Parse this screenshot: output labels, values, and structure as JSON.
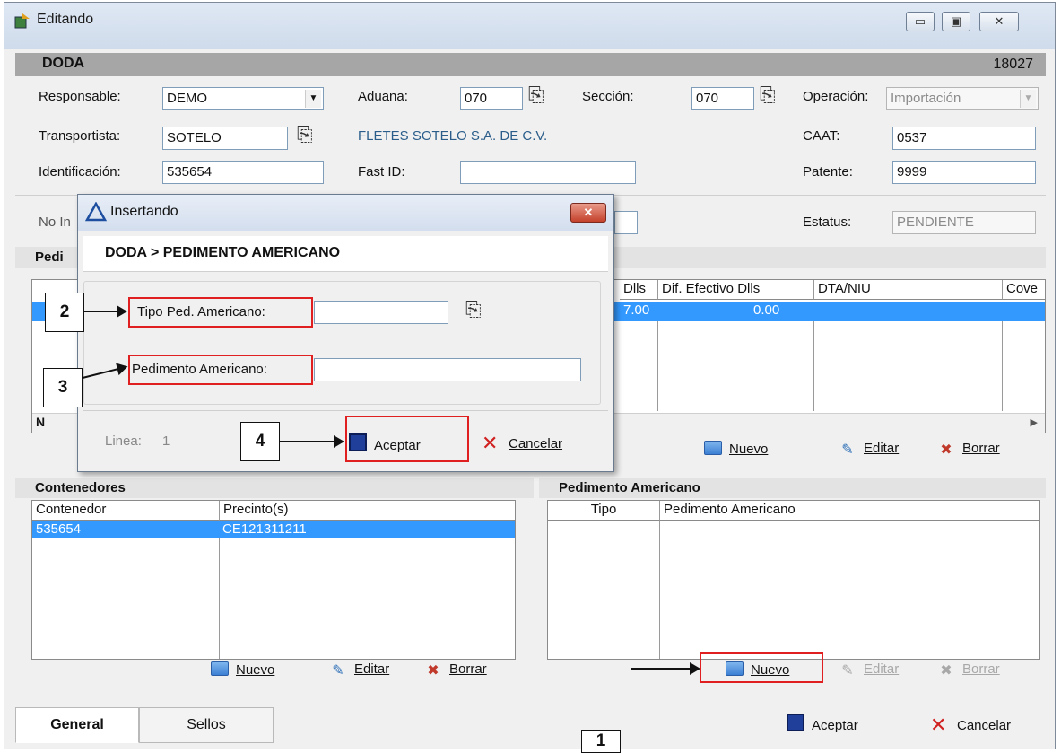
{
  "window": {
    "title": "Editando",
    "header_title": "DODA",
    "header_number": "18027",
    "controls": [
      "▭",
      "▣",
      "✕"
    ]
  },
  "form": {
    "responsable_label": "Responsable:",
    "responsable_value": "DEMO",
    "aduana_label": "Aduana:",
    "aduana_value": "070",
    "seccion_label": "Sección:",
    "seccion_value": "070",
    "operacion_label": "Operación:",
    "operacion_value": "Importación",
    "transportista_label": "Transportista:",
    "transportista_value": "SOTELO",
    "transportista_name": "FLETES SOTELO S.A. DE C.V.",
    "caat_label": "CAAT:",
    "caat_value": "0537",
    "identificacion_label": "Identificación:",
    "identificacion_value": "535654",
    "fastid_label": "Fast ID:",
    "fastid_value": "",
    "patente_label": "Patente:",
    "patente_value": "9999",
    "noin_label": "No In",
    "estatus_label": "Estatus:",
    "estatus_value": "PENDIENTE"
  },
  "pedimentos": {
    "section_label": "Pedi",
    "columns": [
      "Dlls",
      "Dif. Efectivo Dlls",
      "DTA/NIU",
      "Cove"
    ],
    "row": [
      "7.00",
      "0.00",
      "",
      ""
    ],
    "nav_label": "N",
    "toolbar": {
      "nuevo": "Nuevo",
      "editar": "Editar",
      "borrar": "Borrar"
    }
  },
  "contenedores": {
    "title": "Contenedores",
    "columns": [
      "Contenedor",
      "Precinto(s)"
    ],
    "rows": [
      {
        "contenedor": "535654",
        "precinto": "CE121311211"
      }
    ],
    "toolbar": {
      "nuevo": "Nuevo",
      "editar": "Editar",
      "borrar": "Borrar"
    }
  },
  "pedimento_americano": {
    "title": "Pedimento Americano",
    "columns": [
      "Tipo",
      "Pedimento Americano"
    ],
    "toolbar": {
      "nuevo": "Nuevo",
      "editar": "Editar",
      "borrar": "Borrar"
    }
  },
  "footer": {
    "aceptar": "Aceptar",
    "cancelar": "Cancelar"
  },
  "tabs": [
    "General",
    "Sellos"
  ],
  "dialog": {
    "title": "Insertando",
    "header": "DODA > PEDIMENTO AMERICANO",
    "tipo_label": "Tipo Ped. Americano:",
    "tipo_value": "",
    "pedimento_label": "Pedimento Americano:",
    "pedimento_value": "",
    "linea_label": "Linea:",
    "linea_value": "1",
    "aceptar": "Aceptar",
    "cancelar": "Cancelar"
  },
  "callouts": [
    "1",
    "2",
    "3",
    "4"
  ],
  "colors": {
    "selection": "#3399ff",
    "highlight_box": "#e02020",
    "header_bar": "#a6a6a6"
  }
}
